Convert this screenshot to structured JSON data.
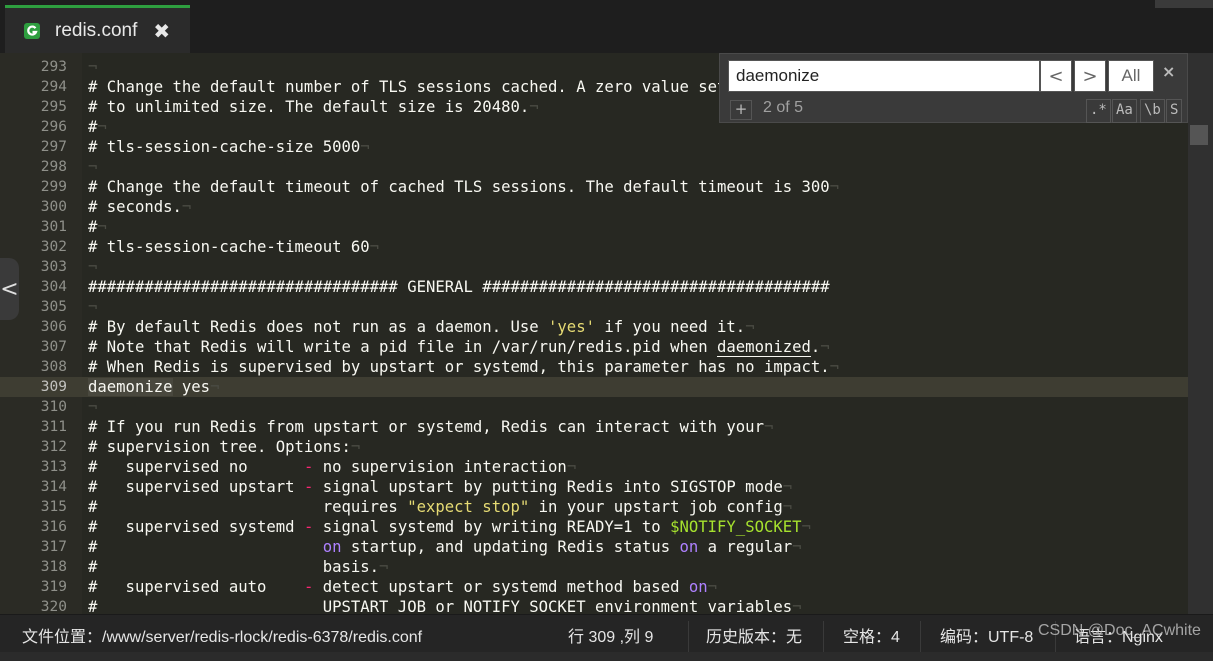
{
  "tab": {
    "filename": "redis.conf",
    "close": "✖"
  },
  "search": {
    "query": "daemonize",
    "prev": "<",
    "next": ">",
    "all": "All",
    "close": "×",
    "add": "+",
    "count": "2 of 5",
    "regex": ".*",
    "case": "Aa",
    "word": "\\b",
    "selection": "S"
  },
  "gutter": {
    "collapse": "<"
  },
  "lines": {
    "293": "",
    "294": "# Change the default number of TLS sessions cached. A zero value sets the cache",
    "295": "# to unlimited size. The default size is 20480.",
    "296": "#",
    "297": "# tls-session-cache-size 5000",
    "298": "",
    "299": "# Change the default timeout of cached TLS sessions. The default timeout is 300",
    "300": "# seconds.",
    "301": "#",
    "302": "# tls-session-cache-timeout 60",
    "303": "",
    "304": "################################# GENERAL #####################################",
    "305": "",
    "306a": "# By default Redis does not run as a daemon. Use ",
    "306b": "'yes'",
    "306c": " if you need it.",
    "307a": "# Note that Redis will write a pid file in /var/run/redis.pid when ",
    "307b": "daemonized",
    "307c": ".",
    "308": "# When Redis is supervised by upstart or systemd, this parameter has no impact.",
    "309a": "daemonize",
    "309b": " yes",
    "310": "",
    "311": "# If you run Redis from upstart or systemd, Redis can interact with your",
    "312": "# supervision tree. Options:",
    "313a": "#   supervised no      ",
    "313b": "-",
    "313c": " no supervision interaction",
    "314a": "#   supervised upstart ",
    "314b": "-",
    "314c": " signal upstart by putting Redis into SIGSTOP mode",
    "315a": "#                        requires ",
    "315b": "\"expect stop\"",
    "315c": " in your upstart job config",
    "316a": "#   supervised systemd ",
    "316b": "-",
    "316c": " signal systemd by writing READY=1 to ",
    "316d": "$NOTIFY_SOCKET",
    "317a": "#                        ",
    "317b": "on",
    "317c": " startup, and updating Redis status ",
    "317d": "on",
    "317e": " a regular",
    "318": "#                        basis.",
    "319a": "#   supervised auto    ",
    "319b": "-",
    "319c": " detect upstart or systemd method based ",
    "319d": "on",
    "320": "#                        UPSTART_JOB or NOTIFY_SOCKET environment variables"
  },
  "status": {
    "path": "文件位置：/www/server/redis-rlock/redis-6378/redis.conf",
    "cursor": "行 309 ,列 9",
    "history": "历史版本：无",
    "indent": "空格：4",
    "encoding": "编码：UTF-8",
    "language": "语言：Nginx"
  },
  "watermark": "CSDN @Doc_ACwhite",
  "colors": {
    "accent": "#2e9e3f",
    "string": "#e6db74",
    "keyword": "#ae81ff",
    "variable": "#a6e22e",
    "operator": "#f92672"
  }
}
